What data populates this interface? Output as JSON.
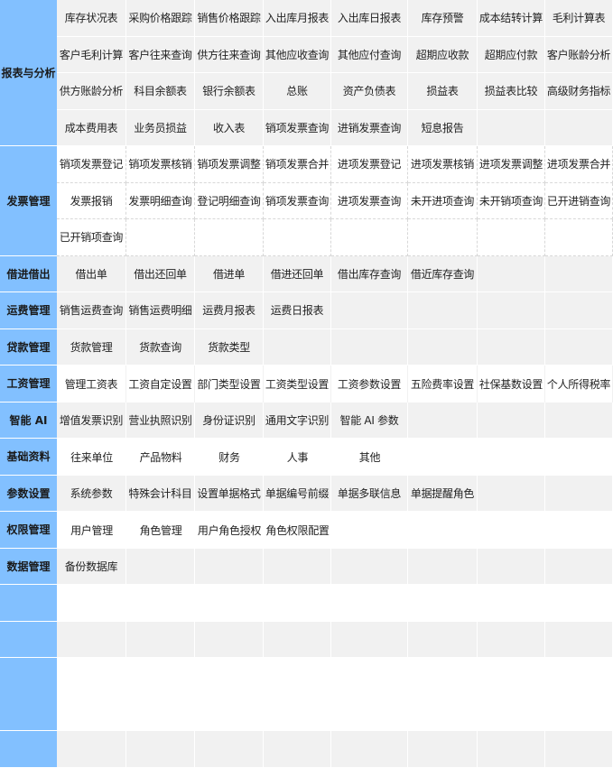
{
  "sections": [
    {
      "title": "报表与分析",
      "rows": 4,
      "style": "gray solid",
      "items": [
        "库存状况表",
        "采购价格跟踪",
        "销售价格跟踪",
        "入出库月报表",
        "入出库日报表",
        "库存预警",
        "成本结转计算",
        "毛利计算表",
        "客户毛利计算",
        "客户往来查询",
        "供方往来查询",
        "其他应收查询",
        "其他应付查询",
        "超期应收款",
        "超期应付款",
        "客户账龄分析",
        "供方账龄分析",
        "科目余额表",
        "银行余额表",
        "总账",
        "资产负债表",
        "损益表",
        "损益表比较",
        "高级财务指标",
        "成本费用表",
        "业务员损益",
        "收入表",
        "销项发票查询",
        "进销发票查询",
        "短息报告"
      ]
    },
    {
      "title": "发票管理",
      "rows": 3,
      "style": "white dashed",
      "items": [
        "销项发票登记",
        "销项发票核销",
        "销项发票调整",
        "销项发票合并",
        "进项发票登记",
        "进项发票核销",
        "进项发票调整",
        "进项发票合并",
        "发票报销",
        "发票明细查询",
        "登记明细查询",
        "销项发票查询",
        "进项发票查询",
        "未开进项查询",
        "未开销项查询",
        "已开进销查询",
        "已开销项查询"
      ]
    },
    {
      "title": "借进借出",
      "rows": 1,
      "style": "gray solid",
      "items": [
        "借出单",
        "借出还回单",
        "借进单",
        "借进还回单",
        "借出库存查询",
        "借近库存查询"
      ]
    },
    {
      "title": "运费管理",
      "rows": 1,
      "style": "gray solid",
      "items": [
        "销售运费查询",
        "销售运费明细",
        "运费月报表",
        "运费日报表"
      ]
    },
    {
      "title": "贷款管理",
      "rows": 1,
      "style": "gray solid",
      "items": [
        "货款管理",
        "货款查询",
        "货款类型"
      ]
    },
    {
      "title": "工资管理",
      "rows": 1,
      "style": "white lines",
      "items": [
        "管理工资表",
        "工资自定设置",
        "部门类型设置",
        "工资类型设置",
        "工资参数设置",
        "五险费率设置",
        "社保基数设置",
        "个人所得税率"
      ]
    },
    {
      "title": "智能 AI",
      "rows": 1,
      "style": "gray solid",
      "items": [
        "增值发票识别",
        "营业执照识别",
        "身份证识别",
        "通用文字识别",
        "智能 AI 参数"
      ]
    },
    {
      "title": "基础资料",
      "rows": 1,
      "style": "white plain",
      "items": [
        "往来单位",
        "产品物料",
        "财务",
        "人事",
        "其他"
      ]
    },
    {
      "title": "参数设置",
      "rows": 1,
      "style": "gray solid",
      "items": [
        "系统参数",
        "特殊会计科目",
        "设置单据格式",
        "单据编号前缀",
        "单据多联信息",
        "单据提醒角色"
      ]
    },
    {
      "title": "权限管理",
      "rows": 1,
      "style": "white plain",
      "items": [
        "用户管理",
        "角色管理",
        "用户角色授权",
        "角色权限配置"
      ]
    },
    {
      "title": "数据管理",
      "rows": 1,
      "style": "gray solid",
      "items": [
        "备份数据库"
      ]
    },
    {
      "title": "",
      "rows": 1,
      "style": "white plain",
      "items": []
    },
    {
      "title": "",
      "rows": 1,
      "style": "gray solid",
      "items": []
    },
    {
      "title": "",
      "rows": 2,
      "style": "white plain",
      "items": []
    },
    {
      "title": "",
      "rows": 1,
      "style": "gray solid",
      "items": []
    }
  ]
}
